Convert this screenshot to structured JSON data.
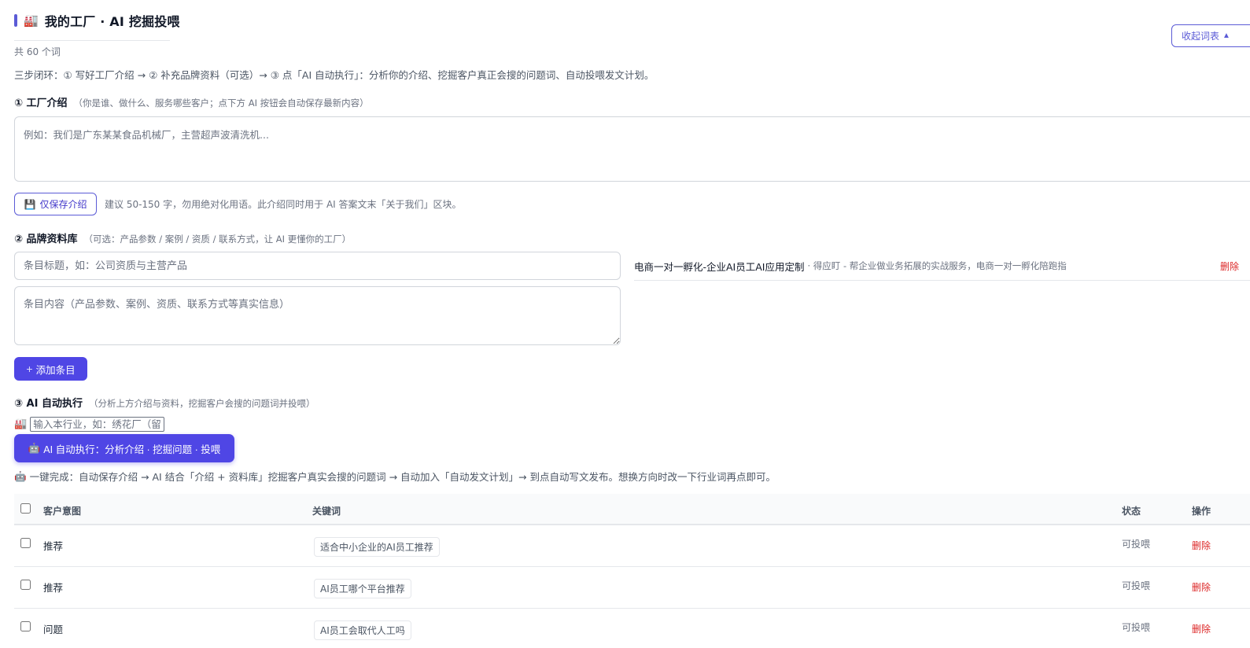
{
  "header": {
    "icon": "factory-icon",
    "title": "我的工厂 · AI 挖掘投喂",
    "word_count": "共 60 个词",
    "collapse_label": "收起词表",
    "collapse_icon": "▲"
  },
  "intro": "三步闭环：① 写好工厂介绍 → ② 补充品牌资料（可选）→ ③ 点「AI 自动执行」：分析你的介绍、挖掘客户真正会搜的问题词、自动投喂发文计划。",
  "step1": {
    "title": "① 工厂介绍",
    "hint": "（你是谁、做什么、服务哪些客户；点下方 AI 按钮会自动保存最新内容）",
    "placeholder": "例如：我们是广东某某食品机械厂，主营超声波清洗机...",
    "save_icon": "💾",
    "save_label": "仅保存介绍",
    "save_hint": "建议 50-150 字，勿用绝对化用语。此介绍同时用于 AI 答案文末「关于我们」区块。"
  },
  "step2": {
    "title": "② 品牌资料库",
    "hint": "（可选：产品参数 / 案例 / 资质 / 联系方式，让 AI 更懂你的工厂）",
    "title_placeholder": "条目标题，如：公司资质与主营产品",
    "content_placeholder": "条目内容（产品参数、案例、资质、联系方式等真实信息）",
    "add_icon": "+",
    "add_label": "添加条目",
    "items": [
      {
        "name": "电商一对一孵化-企业AI员工AI应用定制",
        "desc": " · 得应盯 - 帮企业做业务拓展的实战服务，电商一对一孵化陪跑指",
        "delete_label": "删除"
      }
    ]
  },
  "step3": {
    "title": "③ AI 自动执行",
    "hint": "（分析上方介绍与资料，挖掘客户会搜的问题词并投喂）",
    "industry_icon": "🏭",
    "industry_placeholder": "输入本行业，如：绣花厂（留",
    "run_icon": "🤖",
    "run_label": "AI 自动执行：分析介绍 · 挖掘问题 · 投喂",
    "note_icon": "🤖",
    "note": "一键完成：自动保存介绍 → AI 结合「介绍 + 资料库」挖掘客户真实会搜的问题词 → 自动加入「自动发文计划」→ 到点自动写文发布。想换方向时改一下行业词再点即可。"
  },
  "table": {
    "headers": {
      "intent": "客户意图",
      "keyword": "关键词",
      "status": "状态",
      "action": "操作"
    },
    "rows": [
      {
        "intent": "推荐",
        "keyword": "适合中小企业的AI员工推荐",
        "status": "可投喂",
        "action": "删除"
      },
      {
        "intent": "推荐",
        "keyword": "AI员工哪个平台推荐",
        "status": "可投喂",
        "action": "删除"
      },
      {
        "intent": "问题",
        "keyword": "AI员工会取代人工吗",
        "status": "可投喂",
        "action": "删除"
      }
    ]
  },
  "colors": {
    "accent": "#4f46e5",
    "accent_border": "#5b5bd6",
    "danger": "#dc2626"
  }
}
